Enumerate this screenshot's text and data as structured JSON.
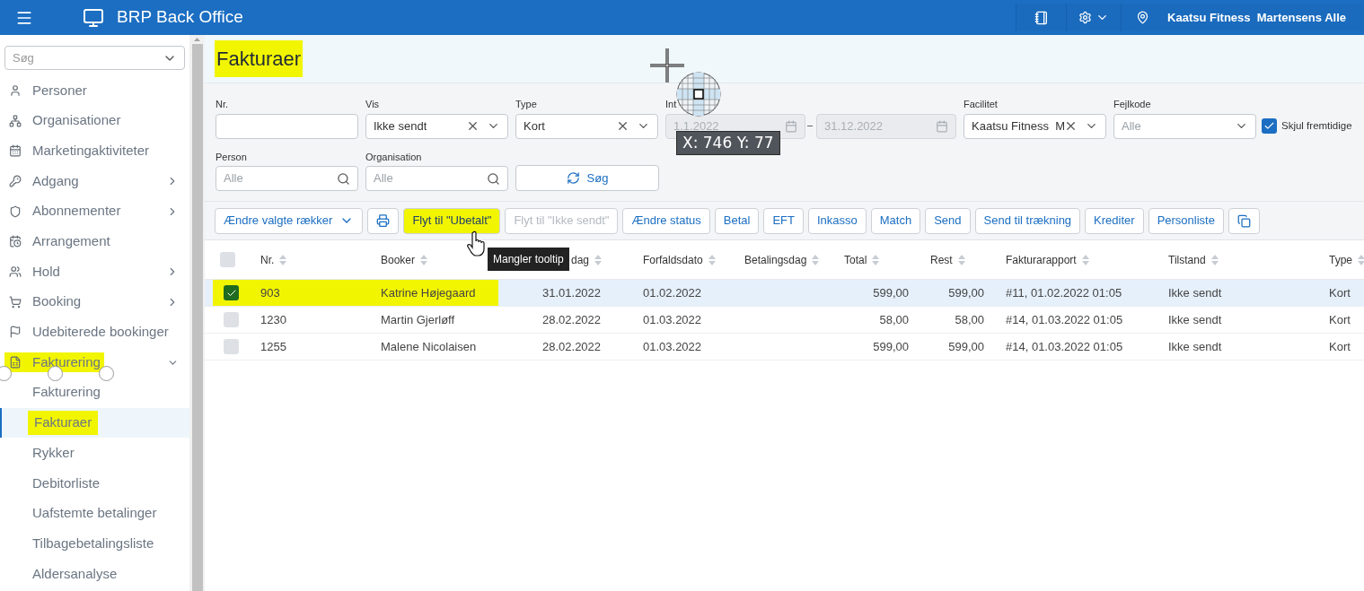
{
  "topbar": {
    "title": "BRP Back Office",
    "location": "Kaatsu Fitness  Martensens Alle"
  },
  "sidebar": {
    "search": {
      "placeholder": "Søg"
    },
    "items": [
      {
        "label": "Personer",
        "has_children": false,
        "highlighted": false
      },
      {
        "label": "Organisationer",
        "has_children": false,
        "highlighted": false
      },
      {
        "label": "Marketingaktiviteter",
        "has_children": false,
        "highlighted": false
      },
      {
        "label": "Adgang",
        "has_children": true,
        "expanded": false,
        "highlighted": false
      },
      {
        "label": "Abonnementer",
        "has_children": true,
        "expanded": false,
        "highlighted": false
      },
      {
        "label": "Arrangement",
        "has_children": false,
        "highlighted": false
      },
      {
        "label": "Hold",
        "has_children": true,
        "expanded": false,
        "highlighted": false
      },
      {
        "label": "Booking",
        "has_children": true,
        "expanded": false,
        "highlighted": false
      },
      {
        "label": "Udebiterede bookinger",
        "has_children": false,
        "highlighted": false
      },
      {
        "label": "Fakturering",
        "has_children": true,
        "expanded": true,
        "highlighted": true,
        "children": [
          {
            "label": "Fakturering",
            "selected": false,
            "highlighted": false
          },
          {
            "label": "Fakturaer",
            "selected": true,
            "highlighted": true
          },
          {
            "label": "Rykker",
            "selected": false,
            "highlighted": false
          },
          {
            "label": "Debitorliste",
            "selected": false,
            "highlighted": false
          },
          {
            "label": "Uafstemte betalinger",
            "selected": false,
            "highlighted": false
          },
          {
            "label": "Tilbagebetalingsliste",
            "selected": false,
            "highlighted": false
          },
          {
            "label": "Aldersanalyse",
            "selected": false,
            "highlighted": false
          }
        ]
      }
    ]
  },
  "page": {
    "title": "Fakturaer",
    "title_highlighted": true
  },
  "filters": [
    [
      {
        "kind": "text",
        "label": "Nr."
      },
      {
        "kind": "select",
        "label": "Vis",
        "value": "Ikke sendt",
        "clearable": true
      },
      {
        "kind": "select",
        "label": "Type",
        "value": "Kort",
        "clearable": true
      },
      {
        "kind": "daterange",
        "label": "Int",
        "from": "1.1.2022",
        "to": "31.12.2022",
        "disabled": true
      },
      {
        "kind": "select",
        "label": "Facilitet",
        "value": "Kaatsu Fitness  M",
        "clearable": true
      },
      {
        "kind": "select",
        "label": "Fejlkode",
        "placeholder": "Alle",
        "clearable": false
      },
      {
        "kind": "checkbox",
        "label": "Skjul fremtidige",
        "checked": true
      }
    ],
    [
      {
        "kind": "search",
        "label": "Person",
        "placeholder": "Alle"
      },
      {
        "kind": "search",
        "label": "Organisation",
        "placeholder": "Alle"
      },
      {
        "kind": "button",
        "label": "Søg"
      }
    ]
  ],
  "toolbar": [
    {
      "kind": "dropdown",
      "label": "Ændre valgte rækker",
      "disabled": false,
      "highlighted": false
    },
    {
      "kind": "print",
      "disabled": false,
      "highlighted": false
    },
    {
      "kind": "text",
      "label": "Flyt til \"Ubetalt\"",
      "disabled": false,
      "highlighted": true
    },
    {
      "kind": "text",
      "label": "Flyt til \"Ikke sendt\"",
      "disabled": true,
      "highlighted": false
    },
    {
      "kind": "text",
      "label": "Ændre status",
      "disabled": false,
      "highlighted": false
    },
    {
      "kind": "text",
      "label": "Betal",
      "disabled": false,
      "highlighted": false
    },
    {
      "kind": "text",
      "label": "EFT",
      "disabled": false,
      "highlighted": false
    },
    {
      "kind": "text",
      "label": "Inkasso",
      "disabled": false,
      "highlighted": false
    },
    {
      "kind": "text",
      "label": "Match",
      "disabled": false,
      "highlighted": false
    },
    {
      "kind": "text",
      "label": "Send",
      "disabled": false,
      "highlighted": false
    },
    {
      "kind": "text",
      "label": "Send til trækning",
      "disabled": false,
      "highlighted": false
    },
    {
      "kind": "text",
      "label": "Krediter",
      "disabled": false,
      "highlighted": false
    },
    {
      "kind": "text",
      "label": "Personliste",
      "disabled": false,
      "highlighted": false
    },
    {
      "kind": "export",
      "disabled": false,
      "highlighted": false
    }
  ],
  "tooltip": "Mangler tooltip",
  "coordinate_readout": "X: 746 Y: 77",
  "table": {
    "all_checked": false,
    "columns": [
      {
        "label": "Nr."
      },
      {
        "label": "Booker"
      },
      {
        "label": "dag"
      },
      {
        "label": "Forfaldsdato"
      },
      {
        "label": "Betalingsdag"
      },
      {
        "label": "Total"
      },
      {
        "label": "Rest"
      },
      {
        "label": "Fakturarapport"
      },
      {
        "label": "Tilstand"
      },
      {
        "label": "Type"
      }
    ],
    "rows": [
      {
        "checked": true,
        "selected": true,
        "highlighted": true,
        "cells": [
          "903",
          "Katrine Højegaard",
          "31.01.2022",
          "01.02.2022",
          null,
          "599,00",
          "599,00",
          "#11, 01.02.2022 01:05",
          "Ikke sendt",
          "Kort"
        ]
      },
      {
        "checked": false,
        "selected": false,
        "highlighted": false,
        "cells": [
          "1230",
          "Martin Gjerløff",
          "28.02.2022",
          "01.03.2022",
          null,
          "58,00",
          "58,00",
          "#14, 01.03.2022 01:05",
          "Ikke sendt",
          "Kort"
        ]
      },
      {
        "checked": false,
        "selected": false,
        "highlighted": false,
        "cells": [
          "1255",
          "Malene Nicolaisen",
          "28.02.2022",
          "01.03.2022",
          null,
          "599,00",
          "599,00",
          "#14, 01.03.2022 01:05",
          "Ikke sendt",
          "Kort"
        ]
      }
    ]
  }
}
